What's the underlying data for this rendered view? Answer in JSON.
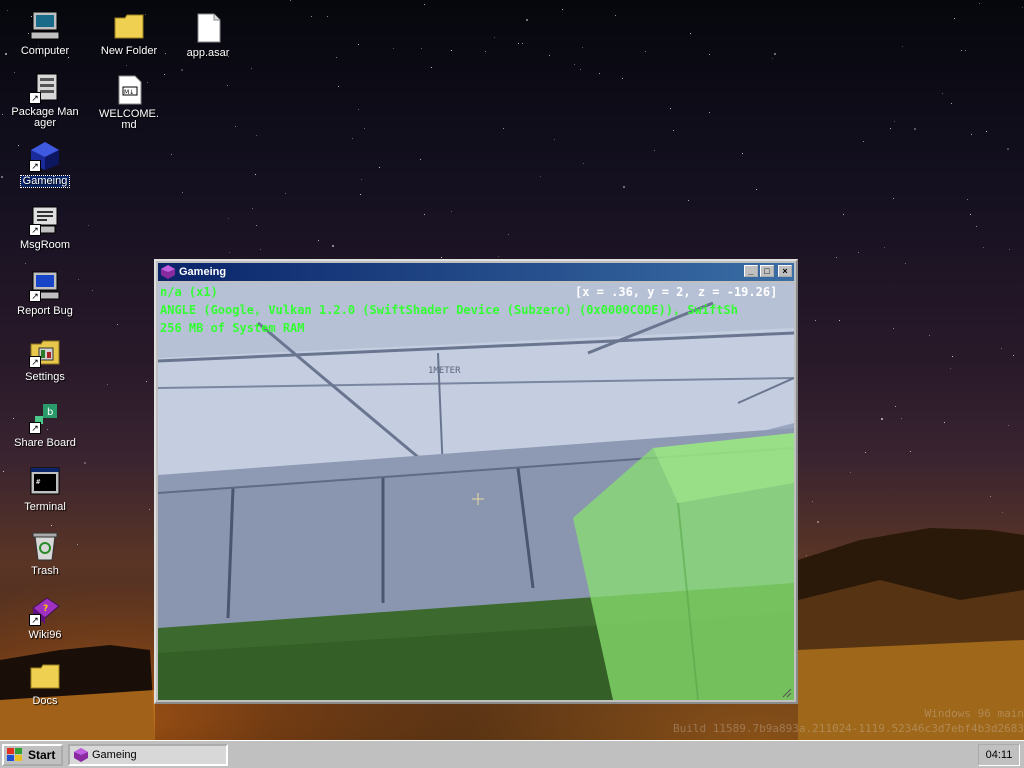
{
  "desktop": {
    "icons": [
      {
        "label": "Computer",
        "icon": "computer-icon"
      },
      {
        "label": "Package Manager",
        "icon": "package-manager-icon"
      },
      {
        "label": "Gameing",
        "icon": "gameing-icon",
        "selected": true
      },
      {
        "label": "MsgRoom",
        "icon": "msgroom-icon"
      },
      {
        "label": "Report Bug",
        "icon": "report-bug-icon"
      },
      {
        "label": "Settings",
        "icon": "settings-icon"
      },
      {
        "label": "Share Board",
        "icon": "share-board-icon"
      },
      {
        "label": "Terminal",
        "icon": "terminal-icon"
      },
      {
        "label": "Trash",
        "icon": "trash-icon"
      },
      {
        "label": "Wiki96",
        "icon": "wiki96-icon"
      },
      {
        "label": "Docs",
        "icon": "folder-icon"
      },
      {
        "label": "New Folder",
        "icon": "folder-icon"
      },
      {
        "label": "WELCOME.md",
        "icon": "markdown-file-icon"
      },
      {
        "label": "app.asar",
        "icon": "file-icon"
      }
    ],
    "watermark": {
      "line1": "Windows 96 main",
      "line2": "Build 11589.7b9a893a.211024-1119.52346c3d7ebf4b3d2683"
    }
  },
  "window": {
    "title": "Gameing",
    "icon": "gameing-icon",
    "controls": {
      "minimize": "_",
      "maximize": "□",
      "close": "×"
    },
    "hud": {
      "fps": "n/a (x1)",
      "coords": "[x = .36, y = 2, z = -19.26]",
      "renderer": "ANGLE (Google, Vulkan 1.2.0 (SwiftShader Device (Subzero) (0x0000C0DE)), SwiftSh",
      "ram": "256 MB of System RAM"
    },
    "scene": {
      "ceiling_label": "1METER",
      "colors": {
        "ceiling": "#c6d0e2",
        "wall": "#8c98b2",
        "grass": "#3e6a30",
        "cube": "#8ee07a"
      }
    }
  },
  "taskbar": {
    "start_label": "Start",
    "tasks": [
      {
        "label": "Gameing",
        "icon": "gameing-icon",
        "active": true
      }
    ],
    "clock": "04:11"
  }
}
